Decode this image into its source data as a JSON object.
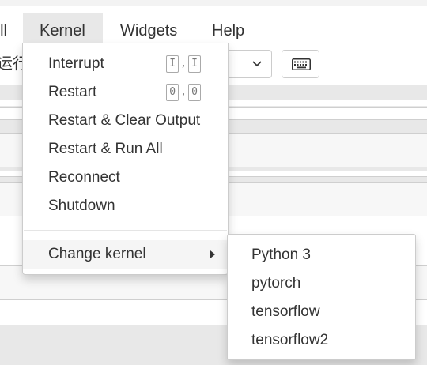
{
  "menubar": {
    "items": [
      {
        "label": "ll"
      },
      {
        "label": "Kernel"
      },
      {
        "label": "Widgets"
      },
      {
        "label": "Help"
      }
    ]
  },
  "toolbar": {
    "cell_type_text": "运行",
    "keyboard_icon": "keyboard-icon",
    "select_icon": "chevron-down-icon"
  },
  "kernel_menu": {
    "items": [
      {
        "label": "Interrupt",
        "shortcut": [
          "I",
          "I"
        ],
        "shortcut_sep": ","
      },
      {
        "label": "Restart",
        "shortcut": [
          "0",
          "0"
        ],
        "shortcut_sep": ","
      },
      {
        "label": "Restart & Clear Output"
      },
      {
        "label": "Restart & Run All"
      },
      {
        "label": "Reconnect"
      },
      {
        "label": "Shutdown"
      },
      {
        "label": "Change kernel",
        "has_submenu": true
      }
    ]
  },
  "change_kernel_submenu": {
    "items": [
      {
        "label": "Python 3"
      },
      {
        "label": "pytorch"
      },
      {
        "label": "tensorflow"
      },
      {
        "label": "tensorflow2"
      }
    ]
  },
  "colors": {
    "menu_active_bg": "#e8e8e8",
    "menu_hover_bg": "#f5f5f5",
    "text": "#333333",
    "border": "#cccccc"
  }
}
